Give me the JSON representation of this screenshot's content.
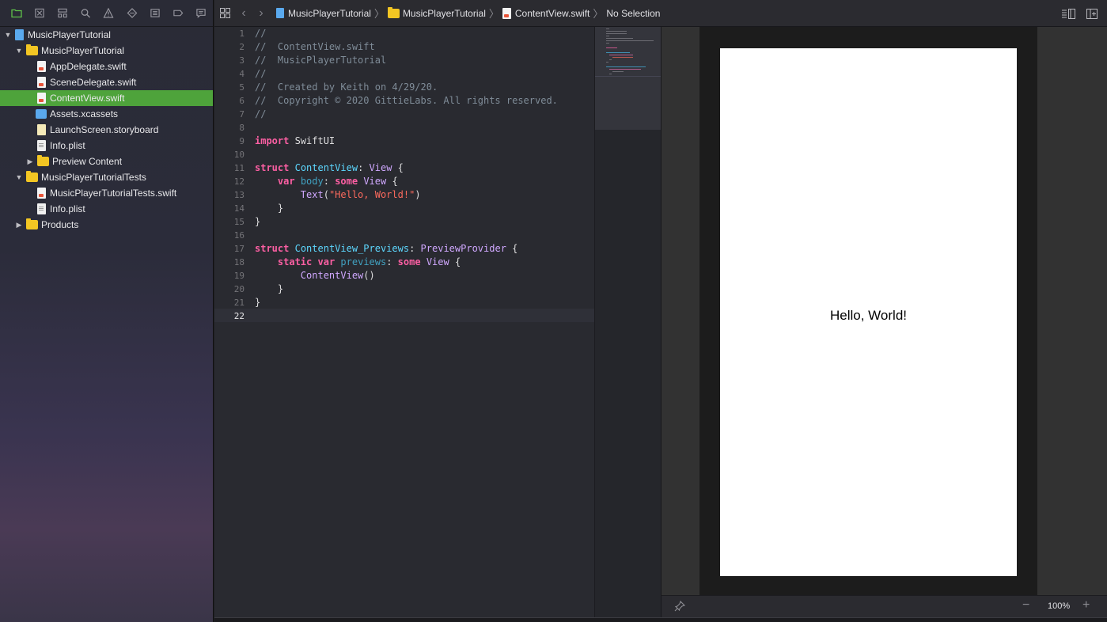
{
  "navigator": {
    "toolbar_icons": [
      "folder-icon",
      "source-control-icon",
      "symbol-icon",
      "search-icon",
      "issue-warning-icon",
      "test-icon",
      "debug-icon",
      "breakpoint-icon",
      "report-icon"
    ],
    "items": [
      {
        "label": "MusicPlayerTutorial",
        "type": "project"
      },
      {
        "label": "MusicPlayerTutorial",
        "type": "folder"
      },
      {
        "label": "AppDelegate.swift",
        "type": "swift"
      },
      {
        "label": "SceneDelegate.swift",
        "type": "swift"
      },
      {
        "label": "ContentView.swift",
        "type": "swift"
      },
      {
        "label": "Assets.xcassets",
        "type": "assets"
      },
      {
        "label": "LaunchScreen.storyboard",
        "type": "storyboard"
      },
      {
        "label": "Info.plist",
        "type": "plist"
      },
      {
        "label": "Preview Content",
        "type": "folder"
      },
      {
        "label": "MusicPlayerTutorialTests",
        "type": "folder"
      },
      {
        "label": "MusicPlayerTutorialTests.swift",
        "type": "swift"
      },
      {
        "label": "Info.plist",
        "type": "plist"
      },
      {
        "label": "Products",
        "type": "folder"
      }
    ]
  },
  "jumpbar": {
    "crumbs": [
      "MusicPlayerTutorial",
      "MusicPlayerTutorial",
      "ContentView.swift",
      "No Selection"
    ]
  },
  "editor": {
    "line_numbers": [
      "1",
      "2",
      "3",
      "4",
      "5",
      "6",
      "7",
      "8",
      "9",
      "10",
      "11",
      "12",
      "13",
      "14",
      "15",
      "16",
      "17",
      "18",
      "19",
      "20",
      "21",
      "22"
    ],
    "current_line": "22",
    "comments": {
      "l1": "//",
      "l2": "//  ContentView.swift",
      "l3": "//  MusicPlayerTutorial",
      "l4": "//",
      "l5": "//  Created by Keith on 4/29/20.",
      "l6": "//  Copyright © 2020 GittieLabs. All rights reserved.",
      "l7": "//"
    },
    "tokens": {
      "import_kw": "import",
      "swiftui": " SwiftUI",
      "struct_kw": "struct",
      "contentview": "ContentView",
      "colon": ": ",
      "view_type": "View",
      "brace_open": " {",
      "var_kw": "var",
      "body": "body",
      "some_kw": "some",
      "text_fn": "Text",
      "paren_open": "(",
      "hello_str": "\"Hello, World!\"",
      "paren_close": ")",
      "brace_close": "}",
      "previews_type": "ContentView_Previews",
      "preview_provider": "PreviewProvider",
      "static_kw": "static",
      "previews": "previews",
      "contentview_call": "ContentView",
      "call_parens": "()"
    }
  },
  "preview": {
    "text": "Hello, World!"
  },
  "canvas_footer": {
    "zoom": "100%",
    "zoom_out_symbol": "−",
    "zoom_in_symbol": "+"
  }
}
